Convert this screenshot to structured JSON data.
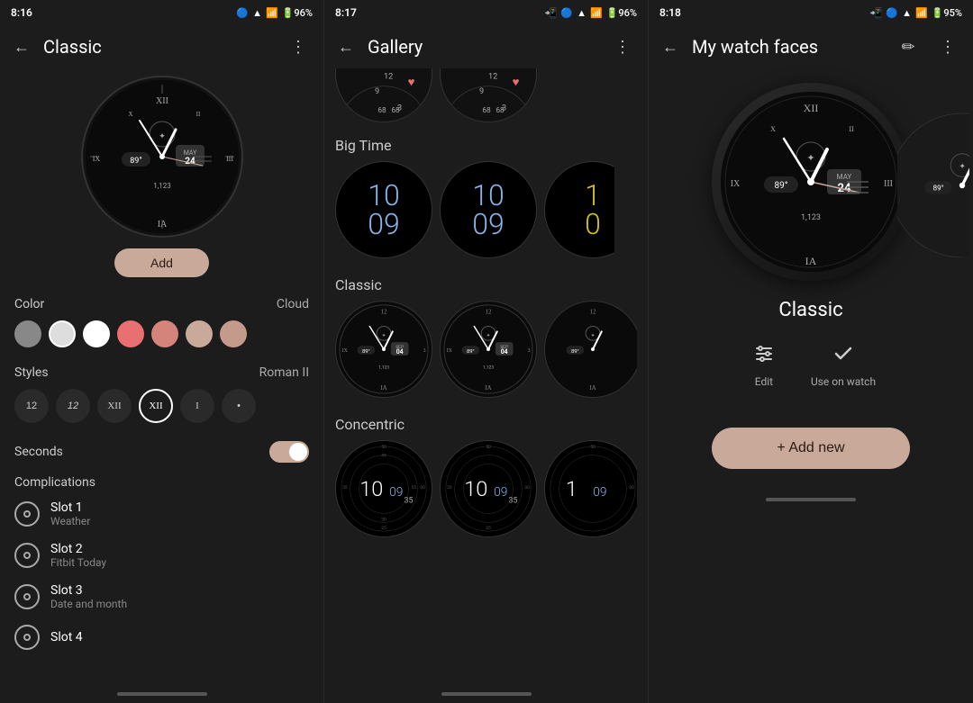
{
  "panels": {
    "left": {
      "statusBar": {
        "time": "8:16",
        "icons": "🔵 ▲ 📶 🔋 96%"
      },
      "toolbar": {
        "backLabel": "←",
        "title": "Classic",
        "menuLabel": "⋮"
      },
      "addButton": "Add",
      "color": {
        "label": "Color",
        "value": "Cloud",
        "swatches": [
          "#888888",
          "#dddddd",
          "#ffffff",
          "#e87070",
          "#d4847a",
          "#c9a99a",
          "#c49a8a"
        ]
      },
      "styles": {
        "label": "Styles",
        "value": "Roman II",
        "options": [
          "12",
          "12",
          "XII",
          "XII",
          "I",
          "•"
        ]
      },
      "seconds": {
        "label": "Seconds",
        "enabled": true
      },
      "complications": {
        "label": "Complications",
        "slots": [
          {
            "title": "Slot 1",
            "subtitle": "Weather"
          },
          {
            "title": "Slot 2",
            "subtitle": "Fitbit Today"
          },
          {
            "title": "Slot 3",
            "subtitle": "Date and month"
          },
          {
            "title": "Slot 4",
            "subtitle": ""
          }
        ]
      }
    },
    "middle": {
      "statusBar": {
        "time": "8:17",
        "icons": "📲 🔵 ▲ 📶 🔋 96%"
      },
      "toolbar": {
        "backLabel": "←",
        "title": "Gallery",
        "menuLabel": "⋮"
      },
      "sections": [
        {
          "title": "Big Time",
          "faces": [
            {
              "type": "big-time",
              "color": "blue"
            },
            {
              "type": "big-time",
              "color": "blue"
            },
            {
              "type": "big-time",
              "color": "yellow",
              "partial": true
            }
          ]
        },
        {
          "title": "Classic",
          "faces": [
            {
              "type": "classic"
            },
            {
              "type": "classic"
            },
            {
              "type": "classic",
              "partial": true
            }
          ]
        },
        {
          "title": "Concentric",
          "faces": [
            {
              "type": "concentric"
            },
            {
              "type": "concentric"
            },
            {
              "type": "concentric",
              "partial": true
            }
          ]
        }
      ]
    },
    "right": {
      "statusBar": {
        "time": "8:18",
        "icons": "📲 🔵 ▲ 📶 🔋 95%"
      },
      "toolbar": {
        "backLabel": "←",
        "title": "My watch faces",
        "editLabel": "✏",
        "menuLabel": "⋮"
      },
      "watchName": "Classic",
      "actions": [
        {
          "icon": "sliders",
          "label": "Edit"
        },
        {
          "icon": "check",
          "label": "Use on watch"
        }
      ],
      "addNewButton": "+ Add new"
    }
  }
}
